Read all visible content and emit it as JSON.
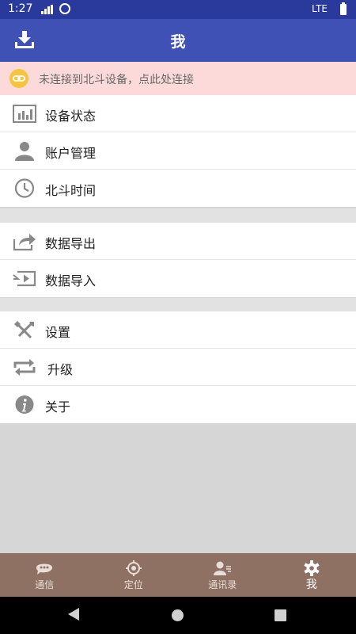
{
  "status_bar": {
    "time": "1:27",
    "network": "LTE"
  },
  "app_bar": {
    "title": "我"
  },
  "banner": {
    "text": "未连接到北斗设备，点此处连接"
  },
  "groups": [
    {
      "items": [
        {
          "label": "设备状态",
          "icon": "chart-icon"
        },
        {
          "label": "账户管理",
          "icon": "person-icon"
        },
        {
          "label": "北斗时间",
          "icon": "clock-icon"
        }
      ]
    },
    {
      "items": [
        {
          "label": "数据导出",
          "icon": "share-icon"
        },
        {
          "label": "数据导入",
          "icon": "import-icon"
        }
      ]
    },
    {
      "items": [
        {
          "label": "设置",
          "icon": "tools-icon"
        },
        {
          "label": "升级",
          "icon": "refresh-icon"
        },
        {
          "label": "关于",
          "icon": "info-icon"
        }
      ]
    }
  ],
  "bottom_nav": [
    {
      "label": "通信",
      "icon": "chat-icon"
    },
    {
      "label": "定位",
      "icon": "location-icon"
    },
    {
      "label": "通讯录",
      "icon": "contacts-icon"
    },
    {
      "label": "我",
      "icon": "gear-icon",
      "active": true
    }
  ]
}
